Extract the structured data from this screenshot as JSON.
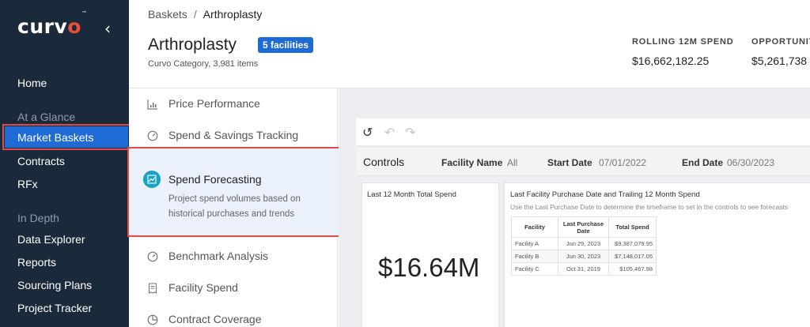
{
  "sidebar": {
    "logo_text": "curvo",
    "logo_tm": "™",
    "collapse_icon": "chevron-left-icon",
    "items": [
      {
        "label": "Home"
      },
      {
        "label": "Market Baskets"
      },
      {
        "label": "Contracts"
      },
      {
        "label": "RFx"
      },
      {
        "label": "Data Explorer"
      },
      {
        "label": "Reports"
      },
      {
        "label": "Sourcing Plans"
      },
      {
        "label": "Project Tracker"
      }
    ],
    "sections": {
      "at_a_glance": "At a Glance",
      "in_depth": "In Depth"
    },
    "active_item": "Market Baskets"
  },
  "header": {
    "breadcrumb": {
      "parent": "Baskets",
      "separator": "/",
      "current": "Arthroplasty"
    },
    "title": "Arthroplasty",
    "badge": "5 facilities",
    "subtitle": "Curvo Category, 3,981 items",
    "metrics": [
      {
        "label": "ROLLING 12M SPEND",
        "value": "$16,662,182.25"
      },
      {
        "label": "OPPORTUNIT",
        "value": "$5,261,738"
      }
    ]
  },
  "menu": {
    "items": [
      {
        "label": "Price Performance",
        "icon": "bar-chart-icon"
      },
      {
        "label": "Spend & Savings Tracking",
        "icon": "gauge-icon"
      },
      {
        "label": "Benchmark Analysis",
        "icon": "gauge-icon"
      },
      {
        "label": "Facility Spend",
        "icon": "receipt-icon"
      },
      {
        "label": "Contract Coverage",
        "icon": "pie-chart-icon"
      }
    ],
    "active": {
      "label": "Spend Forecasting",
      "icon": "trend-chart-icon",
      "description": "Project spend volumes based on historical purchases and trends"
    }
  },
  "toolbar": {
    "icons": [
      "undo-icon",
      "redo-left-icon",
      "redo-right-icon"
    ]
  },
  "controls": {
    "title": "Controls",
    "facility_label": "Facility Name",
    "facility_value": "All",
    "start_label": "Start Date",
    "start_value": "07/01/2022",
    "end_label": "End Date",
    "end_value": "06/30/2023"
  },
  "card_total": {
    "title": "Last 12 Month Total Spend",
    "value": "$16.64M"
  },
  "card_table": {
    "title": "Last Facility Purchase Date and Trailing 12 Month Spend",
    "subtitle": "Use the Last Purchase Date to determine the timeframe to set in the controls to see forecasts",
    "columns": [
      "Facility",
      "Last Purchase Date",
      "Total Spend"
    ],
    "rows": [
      {
        "facility": "Facility A",
        "date": "Jun 29, 2023",
        "spend": "$9,387,079.95"
      },
      {
        "facility": "Facility B",
        "date": "Jun 30, 2023",
        "spend": "$7,148,017.05"
      },
      {
        "facility": "Facility C",
        "date": "Oct 31, 2019",
        "spend": "$105,467.98"
      }
    ]
  },
  "colors": {
    "sidebar_bg": "#1b2a3a",
    "accent": "#1e6bd6",
    "logo_o": "#e8503a",
    "highlight_outline": "#e34b4b",
    "forecast_icon": "#18a3c4"
  }
}
